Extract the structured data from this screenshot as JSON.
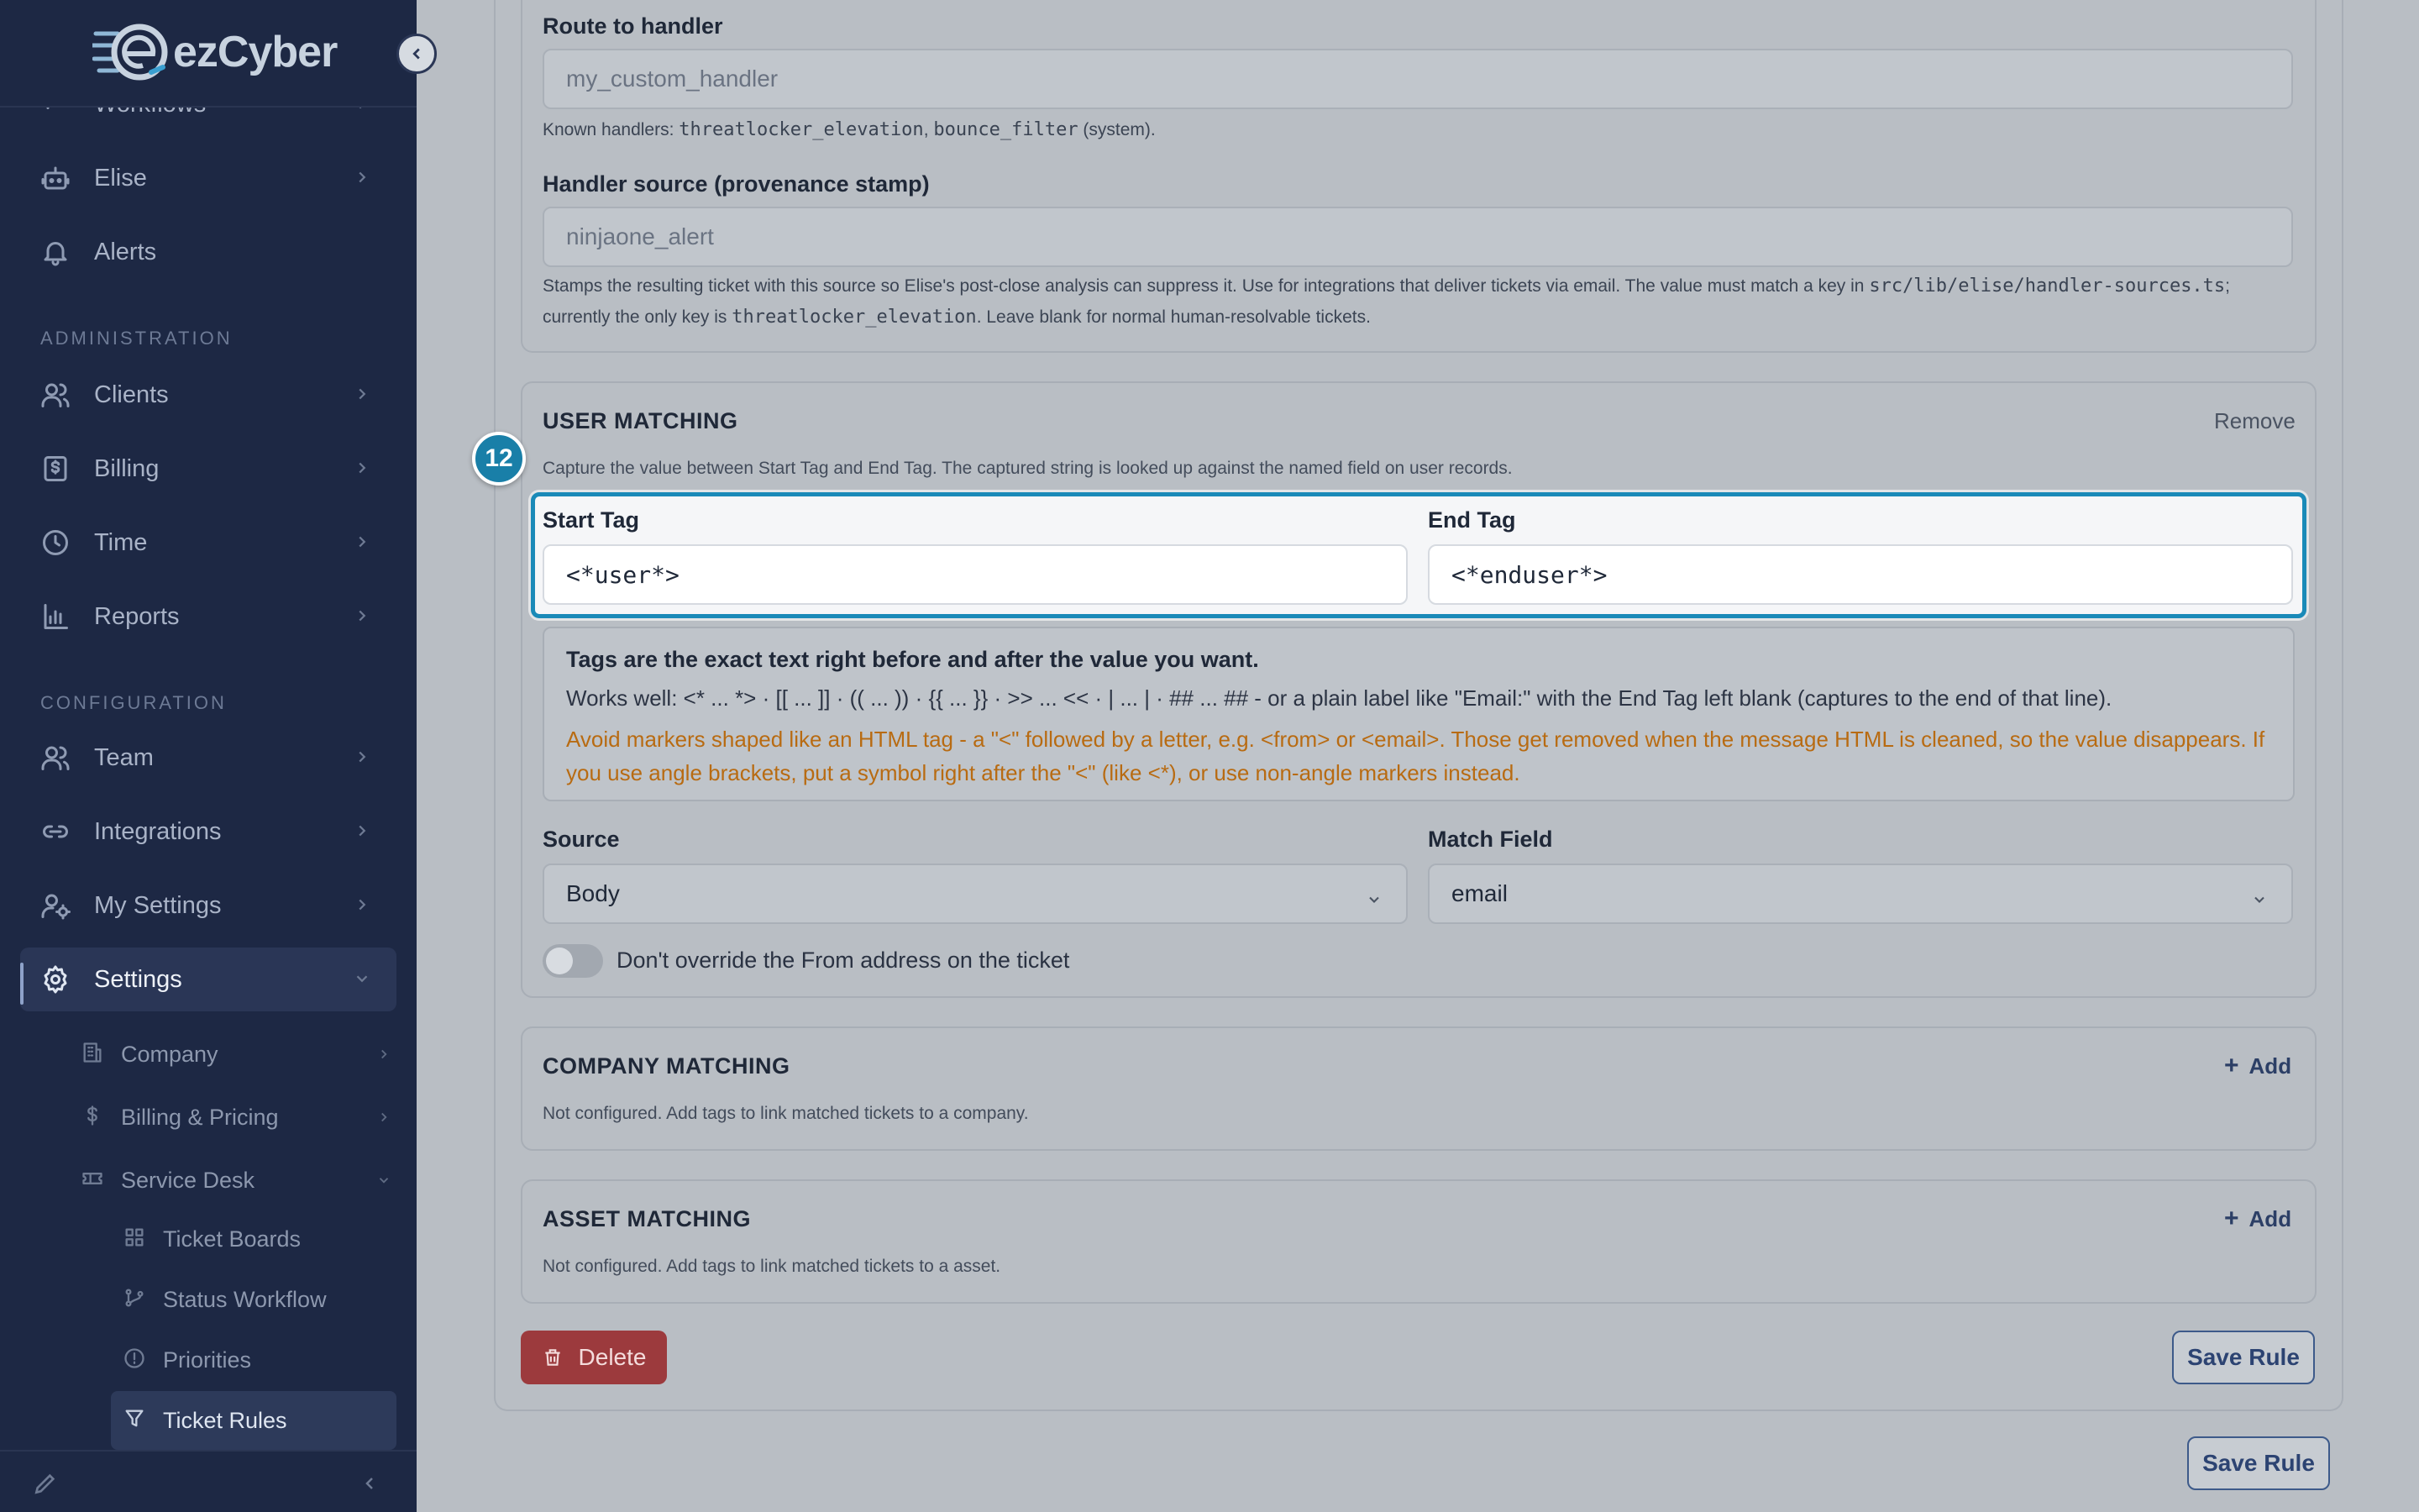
{
  "brand": {
    "logo_text": "ezCyber"
  },
  "sidebar": {
    "items": [
      {
        "label": "Workflows"
      },
      {
        "label": "Elise"
      },
      {
        "label": "Alerts"
      }
    ],
    "section_admin": "ADMINISTRATION",
    "admin_items": [
      {
        "label": "Clients"
      },
      {
        "label": "Billing"
      },
      {
        "label": "Time"
      },
      {
        "label": "Reports"
      }
    ],
    "section_config": "CONFIGURATION",
    "config_items": [
      {
        "label": "Team"
      },
      {
        "label": "Integrations"
      },
      {
        "label": "My Settings"
      },
      {
        "label": "Settings"
      }
    ],
    "settings_children": [
      {
        "label": "Company"
      },
      {
        "label": "Billing & Pricing"
      },
      {
        "label": "Service Desk"
      }
    ],
    "service_desk_children": [
      {
        "label": "Ticket Boards"
      },
      {
        "label": "Status Workflow"
      },
      {
        "label": "Priorities"
      },
      {
        "label": "Ticket Rules"
      }
    ]
  },
  "handler": {
    "route_label": "Route to handler",
    "route_placeholder": "my_custom_handler",
    "known_prefix": "Known handlers:",
    "known_1": "threatlocker_elevation",
    "known_sep": ",",
    "known_2": "bounce_filter",
    "known_suffix": "(system).",
    "source_label": "Handler source (provenance stamp)",
    "source_placeholder": "ninjaone_alert",
    "source_help_1": "Stamps the resulting ticket with this source so Elise's post-close analysis can suppress it. Use for integrations that deliver tickets via email. The value must match a key in",
    "source_help_path": "src/lib/elise/handler-sources.ts",
    "source_help_2": ";",
    "source_help_3": "currently the only key is",
    "source_help_key": "threatlocker_elevation",
    "source_help_4": ". Leave blank for normal human-resolvable tickets."
  },
  "user_matching": {
    "title": "USER MATCHING",
    "remove": "Remove",
    "subtitle": "Capture the value between Start Tag and End Tag. The captured string is looked up against the named field on user records.",
    "badge": "12",
    "start_label": "Start Tag",
    "start_value": "<*user*>",
    "end_label": "End Tag",
    "end_value": "<*enduser*>",
    "tips_title": "Tags are the exact text right before and after the value you want.",
    "tips_works": "Works well: <* ... *> · [[ ... ]] · (( ... )) · {{ ... }} · >> ... << · | ... | · ## ... ## - or a plain label like \"Email:\" with the End Tag left blank (captures to the end of that line).",
    "tips_warn": "Avoid markers shaped like an HTML tag - a \"<\" followed by a letter, e.g. <from> or <email>. Those get removed when the message HTML is cleaned, so the value disappears. If you use angle brackets, put a symbol right after the \"<\" (like <*), or use non-angle markers instead.",
    "source_label": "Source",
    "source_value": "Body",
    "match_label": "Match Field",
    "match_value": "email",
    "toggle_label": "Don't override the From address on the ticket"
  },
  "company_matching": {
    "title": "COMPANY MATCHING",
    "add": "Add",
    "subtitle": "Not configured. Add tags to link matched tickets to a company."
  },
  "asset_matching": {
    "title": "ASSET MATCHING",
    "add": "Add",
    "subtitle": "Not configured. Add tags to link matched tickets to a asset."
  },
  "actions": {
    "delete": "Delete",
    "save_rule": "Save Rule",
    "save_rule_outer": "Save Rule"
  },
  "colors": {
    "sidebar_bg": "#1d2844",
    "highlight": "#1a8ab8",
    "warning_text": "#b86b12",
    "delete_bg": "#9c3a3d"
  }
}
